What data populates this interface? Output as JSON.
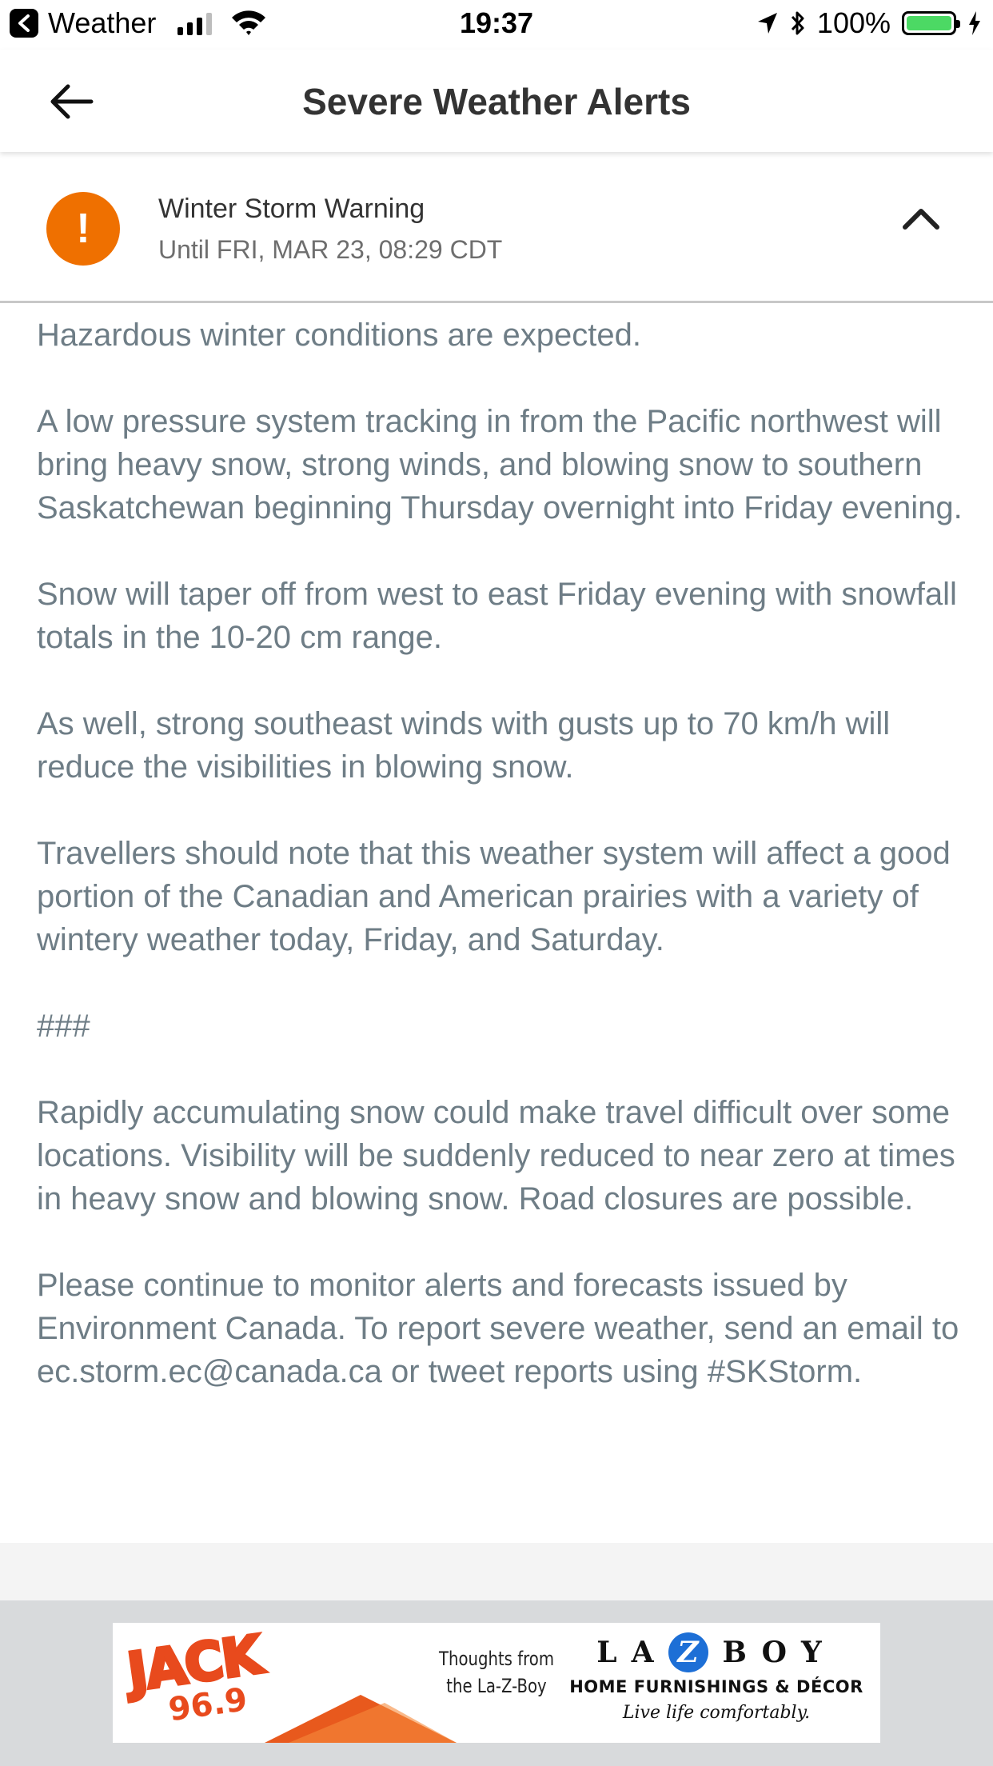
{
  "status_bar": {
    "back_app_label": "Weather",
    "time": "19:37",
    "battery_percent_label": "100%",
    "battery_level": 1.0,
    "icons": [
      "back-chevron-icon",
      "cellular-signal-icon",
      "wifi-icon",
      "location-arrow-icon",
      "bluetooth-icon",
      "battery-icon",
      "charging-bolt-icon"
    ]
  },
  "app_bar": {
    "title": "Severe Weather Alerts",
    "back_icon": "arrow-left-icon"
  },
  "alert": {
    "icon_glyph": "!",
    "icon_color": "#ef7000",
    "title": "Winter Storm Warning",
    "subtitle": "Until FRI, MAR 23, 08:29 CDT",
    "collapse_icon": "chevron-up-icon",
    "paragraphs": [
      "Hazardous winter conditions are expected.",
      "A low pressure system tracking in from the Pacific northwest will bring heavy snow, strong winds, and blowing snow to southern Saskatchewan beginning Thursday overnight into Friday evening.",
      "Snow will taper off from west to east Friday evening with snowfall totals in the 10-20 cm range.",
      "As well, strong southeast winds with gusts up to 70 km/h will reduce the visibilities in blowing snow.",
      "Travellers should note that this weather system will affect a good portion of the Canadian and American prairies with a variety of wintery weather today, Friday, and Saturday.",
      "###",
      "Rapidly accumulating snow could make travel difficult over some locations. Visibility will be suddenly reduced to near zero at times in heavy snow and blowing snow. Road closures are possible.",
      "Please continue to monitor alerts and forecasts issued by Environment Canada. To report severe weather, send an email to ec.storm.ec@canada.ca or tweet reports using #SKStorm."
    ]
  },
  "ad": {
    "station_name": "JACK",
    "station_freq": "96.9",
    "tagline_line1": "Thoughts from",
    "tagline_line2": "the La-Z-Boy",
    "brand_left": "LA",
    "brand_z": "Z",
    "brand_right": "BOY",
    "brand_sub": "HOME FURNISHINGS & DÉCOR",
    "brand_slogan": "Live life comfortably.",
    "accent_color": "#e84a1d",
    "brand_color": "#1d6fd6"
  }
}
